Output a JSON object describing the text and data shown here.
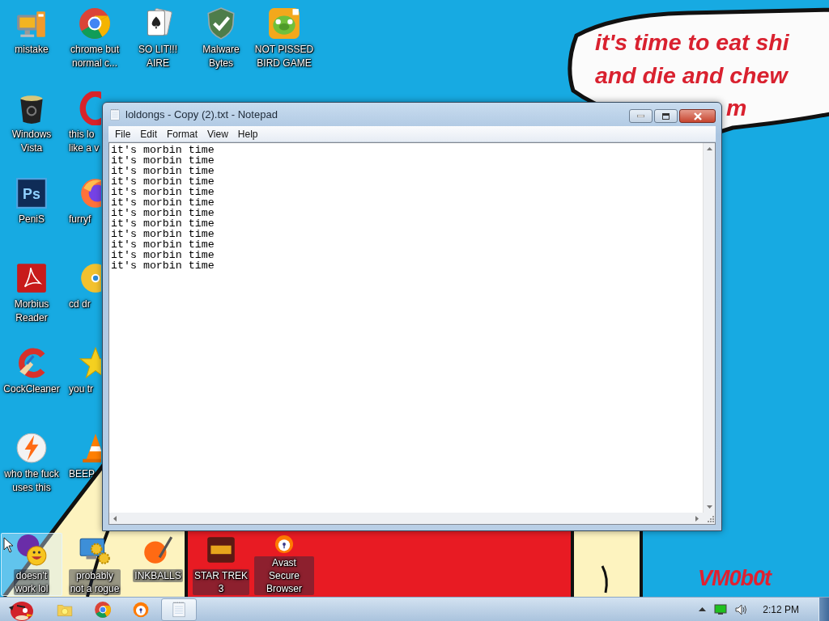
{
  "desktop": {
    "wallpaper": {
      "bubble_lines": [
        "it's time to eat shi",
        "and die and chew",
        "m"
      ],
      "signature": "VM0b0t"
    },
    "columns": [
      [
        {
          "label": "mistake",
          "kind": "computer",
          "selected": false,
          "clipped": false
        },
        {
          "label": "Windows\nVista",
          "kind": "trash",
          "selected": false,
          "clipped": false
        },
        {
          "label": "PeniS",
          "kind": "photoshop",
          "icon_text": "Ps",
          "selected": false,
          "clipped": false
        },
        {
          "label": "Morbius\nReader",
          "kind": "pdf",
          "selected": false,
          "clipped": false
        },
        {
          "label": "CockCleaner",
          "kind": "ccleaner",
          "selected": false,
          "clipped": false
        },
        {
          "label": "who the fuck\nuses this",
          "kind": "lightning",
          "selected": false,
          "clipped": false
        },
        {
          "label": "doesn't\nwork lol",
          "kind": "messenger",
          "selected": true,
          "clipped": false
        }
      ],
      [
        {
          "label": "chrome but\nnormal c...",
          "kind": "chrome",
          "selected": false,
          "clipped": false
        },
        {
          "label": "this lo\nlike a v",
          "kind": "opera",
          "selected": false,
          "clipped": true
        },
        {
          "label": "furryf",
          "kind": "firefox",
          "selected": false,
          "clipped": true
        },
        {
          "label": "cd dr",
          "kind": "disc",
          "selected": false,
          "clipped": true
        },
        {
          "label": "you tr",
          "kind": "star",
          "selected": false,
          "clipped": true
        },
        {
          "label": "BEEP",
          "kind": "cone",
          "selected": false,
          "clipped": true
        },
        {
          "label": "probably\nnot a rogue",
          "kind": "gears",
          "selected": false,
          "clipped": false
        }
      ],
      [
        {
          "label": "SO LIT!!!\nAIRE",
          "kind": "cards",
          "selected": false,
          "clipped": false
        },
        {
          "label": "INKBALLS",
          "kind": "inkball",
          "selected": false,
          "clipped": false
        }
      ],
      [
        {
          "label": "Malware\nBytes",
          "kind": "shield",
          "selected": false,
          "clipped": false
        },
        {
          "label": "STAR TREK\n3",
          "kind": "starwars",
          "selected": false,
          "clipped": false
        }
      ],
      [
        {
          "label": "NOT PISSED\nBIRD GAME",
          "kind": "pig",
          "selected": false,
          "clipped": false
        },
        {
          "label": "Avast Secure\nBrowser",
          "kind": "avast",
          "selected": false,
          "clipped": false
        }
      ]
    ]
  },
  "window": {
    "title": "loldongs - Copy (2).txt - Notepad",
    "menu": [
      "File",
      "Edit",
      "Format",
      "View",
      "Help"
    ],
    "lines": [
      "it's morbin time",
      "it's morbin time",
      "it's morbin time",
      "it's morbin time",
      "it's morbin time",
      "it's morbin time",
      "it's morbin time",
      "it's morbin time",
      "it's morbin time",
      "it's morbin time",
      "it's morbin time",
      "it's morbin time"
    ]
  },
  "taskbar": {
    "buttons": [
      {
        "kind": "folder",
        "active": false
      },
      {
        "kind": "chrome",
        "active": false
      },
      {
        "kind": "avast",
        "active": false
      },
      {
        "kind": "notepad",
        "active": true
      }
    ],
    "clock": "2:12 PM"
  }
}
